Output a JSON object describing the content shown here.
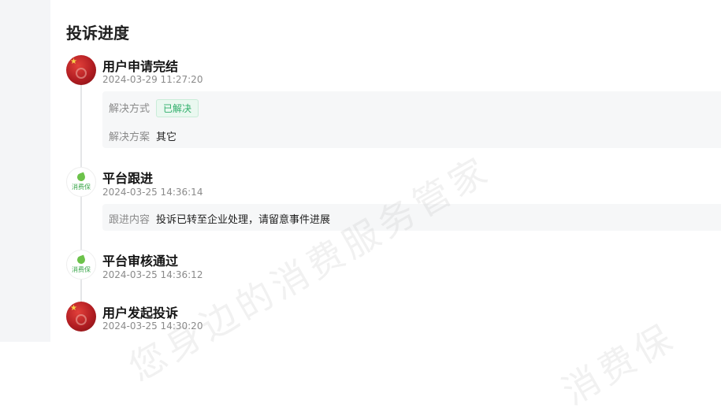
{
  "section_title": "投诉进度",
  "watermark_text": "您身边的消费服务管家",
  "watermark_text_2": "消费保",
  "events": [
    {
      "title": "用户申请完结",
      "time": "2024-03-29 11:27:20",
      "details": {
        "resolution_method_label": "解决方式",
        "resolution_method_value": "已解决",
        "resolution_plan_label": "解决方案",
        "resolution_plan_value": "其它"
      }
    },
    {
      "title": "平台跟进",
      "time": "2024-03-25 14:36:14",
      "details": {
        "followup_label": "跟进内容",
        "followup_value": "投诉已转至企业处理，请留意事件进展"
      }
    },
    {
      "title": "平台审核通过",
      "time": "2024-03-25 14:36:12"
    },
    {
      "title": "用户发起投诉",
      "time": "2024-03-25 14:30:20"
    }
  ],
  "brand_logo_text": "消费保",
  "colors": {
    "tag_green": "#2fae6a",
    "avatar_red": "#b11d22",
    "detail_bg": "#f6f7f8"
  },
  "icons": {
    "user_avatar": "user-avatar-icon",
    "platform_logo": "platform-logo-icon"
  }
}
